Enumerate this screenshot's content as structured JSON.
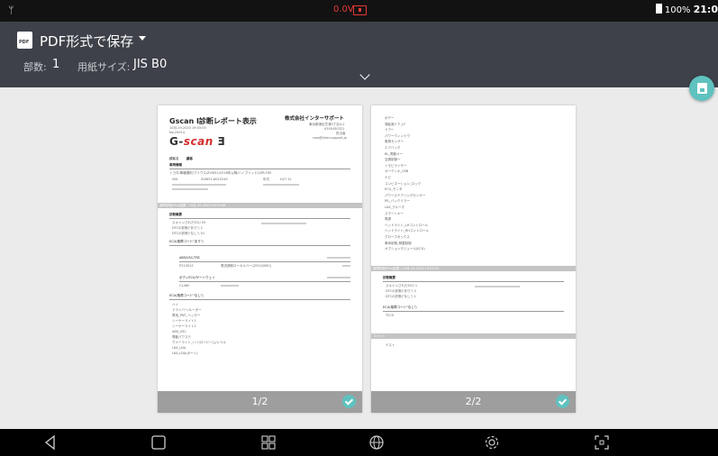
{
  "status_bar": {
    "usb_icon": "usb-icon",
    "voltage": "0.0V",
    "battery_level": "100%",
    "time": "21:0"
  },
  "header": {
    "title": "PDF形式で保存",
    "copies_label": "部数:",
    "copies_value": "1",
    "paper_size_label": "用紙サイズ:",
    "paper_size_value": "JIS B0"
  },
  "colors": {
    "header_bg": "#3e4149",
    "accent": "#5fc2bf",
    "alert": "#e53935",
    "page_footer": "#9e9e9e"
  },
  "pages": [
    {
      "number_label": "1/2",
      "report_title": "Gscan Ⅰ診断レポート表示",
      "report_date": "10月-19-2020 19:03:05",
      "report_no": "No.20014",
      "company": "株式会社インターサポート",
      "company_address": "東京都港区芝浦3丁目4-1",
      "company_tel": "0355430321",
      "company_person": "担当者",
      "company_mail": "csss@inter-support.jp",
      "logo_left": "G-",
      "logo_mid": "scan",
      "logo_right": " Ǝ",
      "customer_label": "顧客名",
      "customer_value": "顧客",
      "vehicle_info": "車両情報",
      "vehicle_line": "トヨタ/車種選択/プリウス/ZVW51/2016年以降/ハイブリッド/2ZR-FXE",
      "vin_label": "VIN",
      "vin_value": "ZVW51-8025249",
      "year_label": "年式",
      "year_value": "H27.12",
      "scan_bar": "故障診断(Pre)結果 / 10月-19-2020 19:03:48",
      "summary_title": "診断概要",
      "summary_1": "スキャンされたECU    53",
      "summary_2": "DTCの診断(\"あり\")   2",
      "summary_3": "DTCの診断(\"なし\")   51",
      "dtc_yes_header": "ECU(故障コード\"あり\")",
      "dtc_yes_1": "ABS/VSC/TRC",
      "dtc_yes_1_code": "P315013",
      "dtc_yes_1_desc": "電流遮断ローカルベースECU(VMC)",
      "dtc_yes_2": "ボディECU/ゲートウェイ",
      "dtc_yes_2_code": "C1460",
      "dtc_no_header": "ECU(故障コード\"なし\")",
      "dtc_no_items": [
        "ハイ",
        "ドライバー/ルーター",
        "電池_PNT_ヘッダー",
        "シーケーライト1",
        "シーケーライト2",
        "ABS_VSC",
        "電動パワステ",
        "ヴァーライト_ハイ/ロービーム/レベル",
        "LKA_LDA",
        "LKA_LDA(ポート)"
      ]
    },
    {
      "number_label": "2/2",
      "list_items": [
        "ボデー",
        "運転席ドア_LF",
        "ドアー",
        "パワーウィンドウ",
        "乗員センサー",
        "エアバッグ",
        "BL_電動オー",
        "空調制御ー",
        "イモビライザー",
        "オーディオ_USB",
        "ナビ",
        "コンビネーション_ロック",
        "ECU_モニタ",
        "パワーステアリングセンサー",
        "IPL_バックミラー",
        "LKA_クルーズ",
        "スマートキー",
        "電源",
        "ヘッドライト_LHコントロール",
        "ヘッドライト_RHコントロール",
        "グローブボックス",
        "車両制御_積載制御",
        "オプションモジュール(ECU)"
      ],
      "scan_bar": "故障診断(Pre)結果 / 10月-19-2020 19:03:57",
      "summary_title": "診断概要",
      "summary_1": "スキャンされたECU    1",
      "summary_2": "DTCの診断(\"あり\")   0",
      "summary_3": "DTCの診断(\"なし\")   1",
      "dtc_no_header": "ECU(故障コード\"なし\")",
      "dtc_no_item": "TCCS",
      "memo_bar": "コメント",
      "memo_text": "テスト"
    }
  ]
}
